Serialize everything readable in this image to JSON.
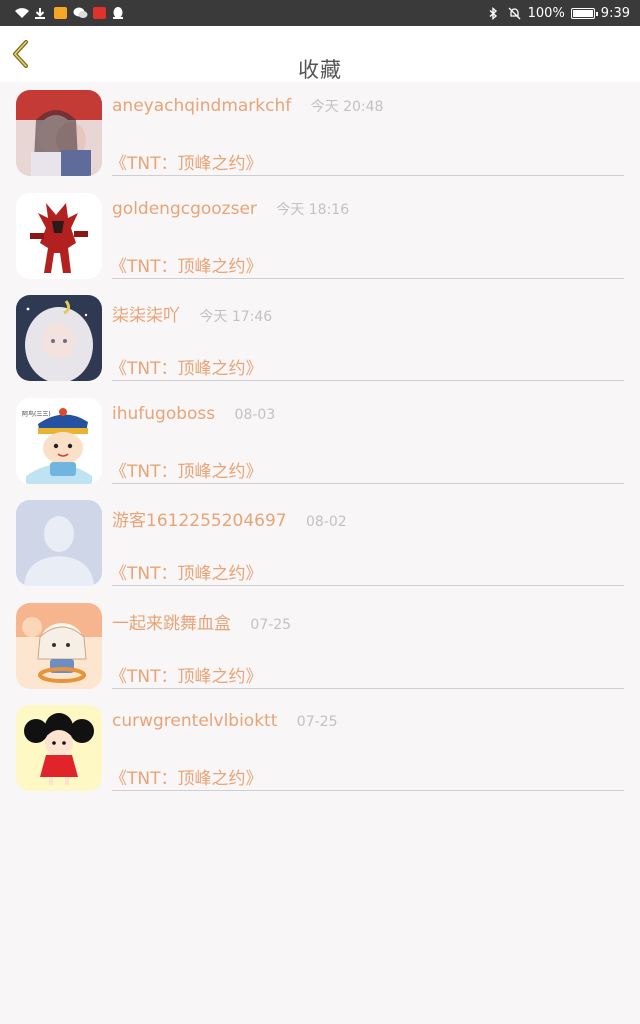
{
  "status_bar": {
    "battery_text": "100%",
    "clock": "9:39"
  },
  "header": {
    "title": "收藏"
  },
  "items": [
    {
      "username": "aneyachqindmarkchf",
      "time": "今天 20:48",
      "work": "《TNT：顶峰之约》",
      "avatar": "avatar-anime-couple"
    },
    {
      "username": "goldengcgoozser",
      "time": "今天 18:16",
      "work": "《TNT：顶峰之约》",
      "avatar": "avatar-red-robot"
    },
    {
      "username": "柒柒柒吖",
      "time": "今天 17:46",
      "work": "《TNT：顶峰之约》",
      "avatar": "avatar-white-hair-girl"
    },
    {
      "username": "ihufugoboss",
      "time": "08-03",
      "work": "《TNT：顶峰之约》",
      "avatar": "avatar-cartoon-boy"
    },
    {
      "username": "游客1612255204697",
      "time": "08-02",
      "work": "《TNT：顶峰之约》",
      "avatar": "avatar-default-person"
    },
    {
      "username": "一起来跳舞血盒",
      "time": "07-25",
      "work": "《TNT：顶峰之约》",
      "avatar": "avatar-cartoon-girl"
    },
    {
      "username": "curwgrentelvlbioktt",
      "time": "07-25",
      "work": "《TNT：顶峰之约》",
      "avatar": "avatar-red-dress-girl"
    }
  ],
  "colors": {
    "accent": "#e8a476",
    "time": "#c2c2c2",
    "background": "#f8f6f7"
  }
}
